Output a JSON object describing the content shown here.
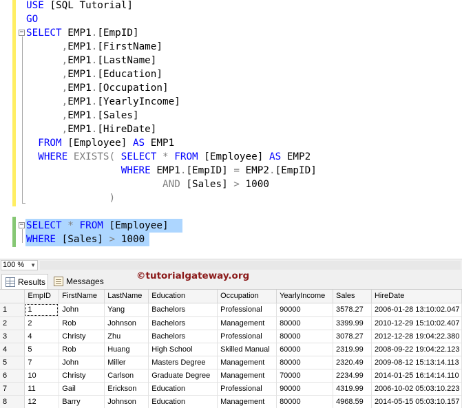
{
  "editor": {
    "lines": [
      [
        {
          "t": "USE ",
          "c": "kw"
        },
        {
          "t": "[SQL Tutorial]",
          "c": "tx"
        }
      ],
      [
        {
          "t": "GO",
          "c": "kw"
        }
      ],
      [
        {
          "t": "SELECT ",
          "c": "kw"
        },
        {
          "t": "EMP1",
          "c": "tx"
        },
        {
          "t": ".",
          "c": "gr"
        },
        {
          "t": "[EmpID]",
          "c": "tx"
        }
      ],
      [
        {
          "t": "      ",
          "c": "tx"
        },
        {
          "t": ",",
          "c": "gr"
        },
        {
          "t": "EMP1",
          "c": "tx"
        },
        {
          "t": ".",
          "c": "gr"
        },
        {
          "t": "[FirstName]",
          "c": "tx"
        }
      ],
      [
        {
          "t": "      ",
          "c": "tx"
        },
        {
          "t": ",",
          "c": "gr"
        },
        {
          "t": "EMP1",
          "c": "tx"
        },
        {
          "t": ".",
          "c": "gr"
        },
        {
          "t": "[LastName]",
          "c": "tx"
        }
      ],
      [
        {
          "t": "      ",
          "c": "tx"
        },
        {
          "t": ",",
          "c": "gr"
        },
        {
          "t": "EMP1",
          "c": "tx"
        },
        {
          "t": ".",
          "c": "gr"
        },
        {
          "t": "[Education]",
          "c": "tx"
        }
      ],
      [
        {
          "t": "      ",
          "c": "tx"
        },
        {
          "t": ",",
          "c": "gr"
        },
        {
          "t": "EMP1",
          "c": "tx"
        },
        {
          "t": ".",
          "c": "gr"
        },
        {
          "t": "[Occupation]",
          "c": "tx"
        }
      ],
      [
        {
          "t": "      ",
          "c": "tx"
        },
        {
          "t": ",",
          "c": "gr"
        },
        {
          "t": "EMP1",
          "c": "tx"
        },
        {
          "t": ".",
          "c": "gr"
        },
        {
          "t": "[YearlyIncome]",
          "c": "tx"
        }
      ],
      [
        {
          "t": "      ",
          "c": "tx"
        },
        {
          "t": ",",
          "c": "gr"
        },
        {
          "t": "EMP1",
          "c": "tx"
        },
        {
          "t": ".",
          "c": "gr"
        },
        {
          "t": "[Sales]",
          "c": "tx"
        }
      ],
      [
        {
          "t": "      ",
          "c": "tx"
        },
        {
          "t": ",",
          "c": "gr"
        },
        {
          "t": "EMP1",
          "c": "tx"
        },
        {
          "t": ".",
          "c": "gr"
        },
        {
          "t": "[HireDate]",
          "c": "tx"
        }
      ],
      [
        {
          "t": "  FROM ",
          "c": "kw"
        },
        {
          "t": "[Employee] ",
          "c": "tx"
        },
        {
          "t": "AS ",
          "c": "kw"
        },
        {
          "t": "EMP1",
          "c": "tx"
        }
      ],
      [
        {
          "t": "  WHERE ",
          "c": "kw"
        },
        {
          "t": "EXISTS",
          "c": "gr"
        },
        {
          "t": "( ",
          "c": "gr"
        },
        {
          "t": "SELECT ",
          "c": "kw"
        },
        {
          "t": "* ",
          "c": "gr"
        },
        {
          "t": "FROM ",
          "c": "kw"
        },
        {
          "t": "[Employee] ",
          "c": "tx"
        },
        {
          "t": "AS ",
          "c": "kw"
        },
        {
          "t": "EMP2",
          "c": "tx"
        }
      ],
      [
        {
          "t": "                ",
          "c": "tx"
        },
        {
          "t": "WHERE ",
          "c": "kw"
        },
        {
          "t": "EMP1",
          "c": "tx"
        },
        {
          "t": ".",
          "c": "gr"
        },
        {
          "t": "[EmpID] ",
          "c": "tx"
        },
        {
          "t": "= ",
          "c": "gr"
        },
        {
          "t": "EMP2",
          "c": "tx"
        },
        {
          "t": ".",
          "c": "gr"
        },
        {
          "t": "[EmpID]",
          "c": "tx"
        }
      ],
      [
        {
          "t": "                       ",
          "c": "tx"
        },
        {
          "t": "AND ",
          "c": "gr"
        },
        {
          "t": "[Sales] ",
          "c": "tx"
        },
        {
          "t": "> ",
          "c": "gr"
        },
        {
          "t": "1000",
          "c": "tx"
        }
      ],
      [
        {
          "t": "              ",
          "c": "tx"
        },
        {
          "t": ")",
          "c": "gr"
        }
      ],
      [],
      [
        {
          "t": "SELECT ",
          "c": "kw"
        },
        {
          "t": "* ",
          "c": "gr"
        },
        {
          "t": "FROM ",
          "c": "kw"
        },
        {
          "t": "[Employee] ",
          "c": "tx"
        }
      ],
      [
        {
          "t": "WHERE ",
          "c": "kw"
        },
        {
          "t": "[Sales] ",
          "c": "tx"
        },
        {
          "t": "> ",
          "c": "gr"
        },
        {
          "t": "1000",
          "c": "tx"
        }
      ]
    ]
  },
  "zoom": {
    "value": "100 %"
  },
  "results_tabs": {
    "results": "Results",
    "messages": "Messages"
  },
  "watermark": "©tutorialgateway.org",
  "grid": {
    "columns": [
      "EmpID",
      "FirstName",
      "LastName",
      "Education",
      "Occupation",
      "YearlyIncome",
      "Sales",
      "HireDate"
    ],
    "rows": [
      [
        "1",
        "1",
        "John",
        "Yang",
        "Bachelors",
        "Professional",
        "90000",
        "3578.27",
        "2006-01-28 13:10:02.047"
      ],
      [
        "2",
        "2",
        "Rob",
        "Johnson",
        "Bachelors",
        "Management",
        "80000",
        "3399.99",
        "2010-12-29 15:10:02.407"
      ],
      [
        "3",
        "4",
        "Christy",
        "Zhu",
        "Bachelors",
        "Professional",
        "80000",
        "3078.27",
        "2012-12-28 19:04:22.380"
      ],
      [
        "4",
        "5",
        "Rob",
        "Huang",
        "High School",
        "Skilled Manual",
        "60000",
        "2319.99",
        "2008-09-22 19:04:22.123"
      ],
      [
        "5",
        "7",
        "John",
        "Miller",
        "Masters Degree",
        "Management",
        "80000",
        "2320.49",
        "2009-08-12 15:13:14.113"
      ],
      [
        "6",
        "10",
        "Christy",
        "Carlson",
        "Graduate Degree",
        "Management",
        "70000",
        "2234.99",
        "2014-01-25 16:14:14.110"
      ],
      [
        "7",
        "11",
        "Gail",
        "Erickson",
        "Education",
        "Professional",
        "90000",
        "4319.99",
        "2006-10-02 05:03:10.223"
      ],
      [
        "8",
        "12",
        "Barry",
        "Johnson",
        "Education",
        "Management",
        "80000",
        "4968.59",
        "2014-05-15 05:03:10.157"
      ]
    ]
  },
  "colors": {
    "keyword": "#0000ff",
    "operator": "#808080",
    "selection": "#add6ff",
    "changed_margin": "#ffee62",
    "saved_margin": "#86c774"
  }
}
